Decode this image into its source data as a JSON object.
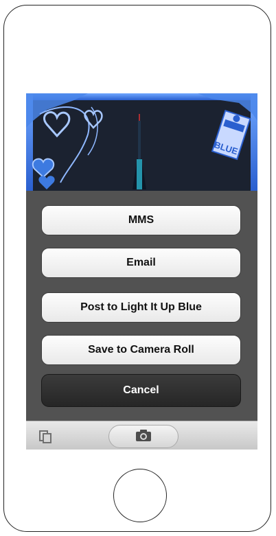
{
  "share_sheet": {
    "mms_label": "MMS",
    "email_label": "Email",
    "post_label": "Post to Light It Up Blue",
    "save_label": "Save to Camera Roll",
    "cancel_label": "Cancel"
  },
  "photo": {
    "badge_text": "BLUE"
  },
  "icons": {
    "copy": "copy-icon",
    "camera": "camera-icon"
  },
  "colors": {
    "sheet_background": "#525252",
    "cancel_background": "#2b2b2b",
    "frame_accent": "#3b79e0",
    "photo_background": "#1b2230"
  }
}
